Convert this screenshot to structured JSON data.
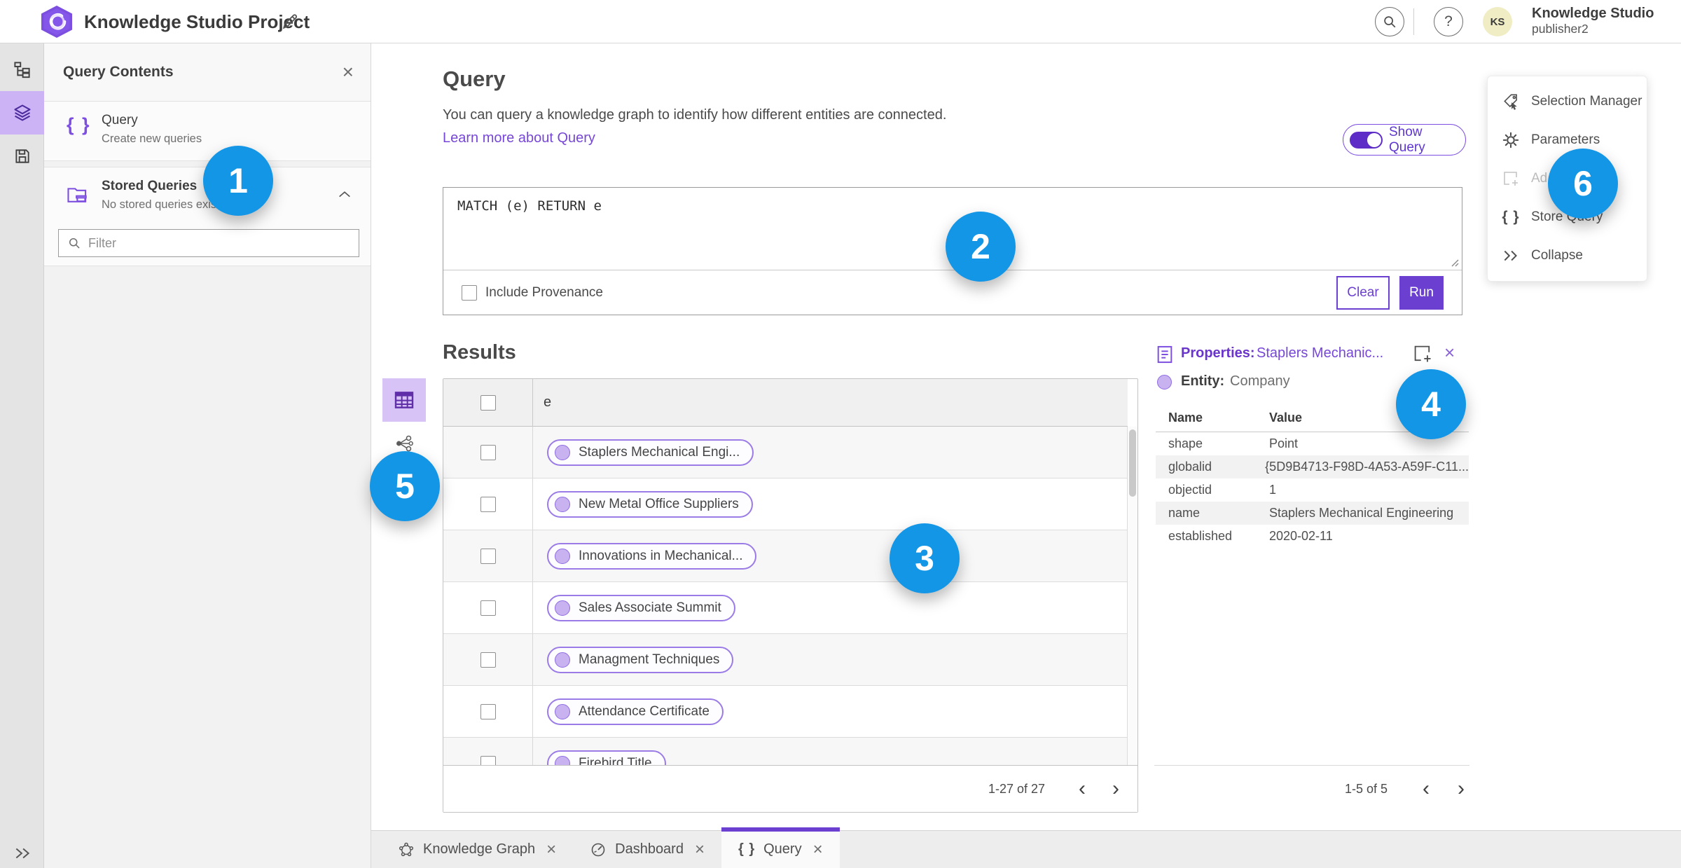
{
  "header": {
    "title": "Knowledge Studio Project",
    "user": {
      "initials": "KS",
      "name": "Knowledge Studio",
      "role": "publisher2"
    }
  },
  "sidebar": {
    "title": "Query Contents",
    "query_item": {
      "title": "Query",
      "subtitle": "Create new queries"
    },
    "stored_item": {
      "title": "Stored Queries",
      "subtitle": "No stored queries exist"
    },
    "filter_placeholder": "Filter"
  },
  "query_section": {
    "title": "Query",
    "description": "You can query a knowledge graph to identify how different entities are connected.",
    "learn_more": "Learn more about Query",
    "show_query_label": "Show Query",
    "code": "MATCH (e) RETURN e",
    "include_provenance_label": "Include Provenance",
    "clear_label": "Clear",
    "run_label": "Run"
  },
  "results": {
    "title": "Results",
    "column_header": "e",
    "rows": [
      {
        "label": "Staplers Mechanical Engi..."
      },
      {
        "label": "New Metal Office Suppliers"
      },
      {
        "label": "Innovations in Mechanical..."
      },
      {
        "label": "Sales Associate Summit"
      },
      {
        "label": "Managment Techniques"
      },
      {
        "label": "Attendance Certificate"
      },
      {
        "label": "Firebird Title"
      }
    ],
    "pagination": {
      "range": "1-27 of 27",
      "prev": "‹",
      "next": "›"
    }
  },
  "properties": {
    "heading": "Properties:",
    "entity_name": "Staplers Mechanic...",
    "entity_label": "Entity:",
    "entity_type": "Company",
    "columns": {
      "name": "Name",
      "value": "Value"
    },
    "rows": [
      {
        "name": "shape",
        "value": "Point"
      },
      {
        "name": "globalid",
        "value": "{5D9B4713-F98D-4A53-A59F-C11..."
      },
      {
        "name": "objectid",
        "value": "1"
      },
      {
        "name": "name",
        "value": "Staplers Mechanical Engineering"
      },
      {
        "name": "established",
        "value": "2020-02-11"
      }
    ],
    "pagination": {
      "range": "1-5 of 5",
      "prev": "‹",
      "next": "›"
    }
  },
  "right_menu": {
    "items": [
      {
        "label": "Selection Manager"
      },
      {
        "label": "Parameters"
      },
      {
        "label": "Ad"
      },
      {
        "label": "Store Query"
      },
      {
        "label": "Collapse"
      }
    ]
  },
  "tabs": [
    {
      "label": "Knowledge Graph"
    },
    {
      "label": "Dashboard"
    },
    {
      "label": "Query"
    }
  ],
  "badges": [
    "1",
    "2",
    "3",
    "4",
    "5",
    "6"
  ],
  "colors": {
    "accent_purple": "#6b3fd0",
    "badge_blue": "#1496e7",
    "pill_purple": "#9b7ce6"
  }
}
